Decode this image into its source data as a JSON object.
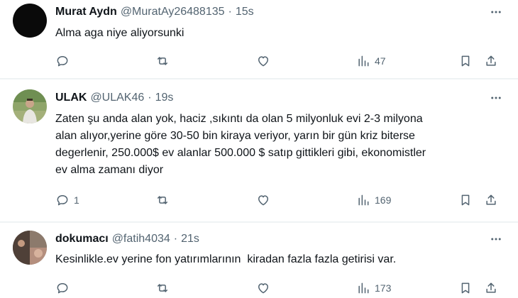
{
  "tweets": [
    {
      "name": "Murat Aydn",
      "handle": "@MuratAy26488135",
      "dot": "·",
      "time": "15s",
      "text": [
        "Alma aga niye aliyorsunki"
      ],
      "replies": "",
      "views": "47"
    },
    {
      "name": "ULAK",
      "handle": "@ULAK46",
      "dot": "·",
      "time": "19s",
      "text": [
        "Zaten şu anda alan yok, haciz ,sıkıntı da olan 5 milyonluk evi 2-3 milyona",
        "alan alıyor,yerine göre 30-50 bin kiraya veriyor, yarın bir gün kriz biterse",
        "degerlenir, 250.000$ ev alanlar 500.000 $ satıp gittikleri gibi, ekonomistler",
        "ev alma zamanı diyor"
      ],
      "replies": "1",
      "views": "169"
    },
    {
      "name": "dokumacı",
      "handle": "@fatih4034",
      "dot": "·",
      "time": "21s",
      "text": [
        "Kesinlikle.ev yerine fon yatırımlarının  kiradan fazla fazla getirisi var."
      ],
      "replies": "",
      "views": "173"
    }
  ],
  "icons": {
    "reply": "reply-icon",
    "retweet": "retweet-icon",
    "like": "like-icon",
    "views": "views-icon",
    "bookmark": "bookmark-icon",
    "share": "share-icon",
    "more": "more-icon"
  }
}
